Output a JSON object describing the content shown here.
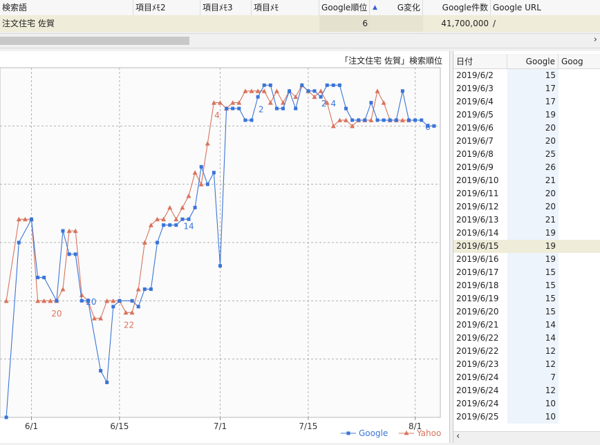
{
  "table": {
    "columns": [
      "検索語",
      "項目ﾒﾓ2",
      "項目ﾒﾓ3",
      "項目ﾒﾓ",
      "Google順位",
      "G変化",
      "Google件数",
      "Google URL"
    ],
    "sort_icon": "sort-ascending-icon",
    "row": {
      "keyword": "注文住宅 佐賀",
      "memo2": "",
      "memo3": "",
      "memo": "",
      "google_rank": "6",
      "g_change": "",
      "google_count": "41,700,000",
      "google_url": "/"
    }
  },
  "scroll_right_icon": "chevron-right-icon",
  "chart_data": {
    "type": "line",
    "title": "「注文住宅 佐賀」検索順位",
    "x_tick_labels": [
      "6/1",
      "6/15",
      "7/1",
      "7/15",
      "8/1"
    ],
    "y_axis": {
      "reversed": true,
      "visible_range": [
        1,
        30
      ],
      "gridlines": [
        5,
        10,
        15,
        20,
        25
      ],
      "tick_labels_visible": false
    },
    "grid": true,
    "legend": "bottom-right",
    "series": [
      {
        "name": "Google",
        "color": "#3a74d8",
        "marker": "square",
        "points": [
          [
            -4,
            30
          ],
          [
            -2,
            15
          ],
          [
            0,
            13
          ],
          [
            1,
            18
          ],
          [
            2,
            18
          ],
          [
            4,
            20
          ],
          [
            5,
            14
          ],
          [
            6,
            16
          ],
          [
            7,
            16
          ],
          [
            8,
            20
          ],
          [
            9,
            20
          ],
          [
            11,
            26
          ],
          [
            12,
            27
          ],
          [
            13,
            20.5
          ],
          [
            14,
            20
          ],
          [
            16,
            20
          ],
          [
            17,
            20.5
          ],
          [
            18,
            19
          ],
          [
            19,
            19
          ],
          [
            20,
            15
          ],
          [
            21,
            13.5
          ],
          [
            22,
            13.5
          ],
          [
            23,
            13.5
          ],
          [
            24,
            13
          ],
          [
            25,
            13
          ],
          [
            26,
            12
          ],
          [
            27,
            8.5
          ],
          [
            28,
            10
          ],
          [
            29,
            9
          ],
          [
            30,
            17
          ],
          [
            31,
            3.5
          ],
          [
            32,
            3.5
          ],
          [
            33,
            3.5
          ],
          [
            34,
            4.5
          ],
          [
            35,
            4.5
          ],
          [
            36,
            2.5
          ],
          [
            37,
            1.5
          ],
          [
            38,
            1.5
          ],
          [
            39,
            3.5
          ],
          [
            40,
            3.5
          ],
          [
            41,
            2
          ],
          [
            42,
            3.5
          ],
          [
            43,
            1.5
          ],
          [
            44,
            2
          ],
          [
            45,
            2
          ],
          [
            46,
            2.5
          ],
          [
            47,
            1.5
          ],
          [
            48,
            1.5
          ],
          [
            49,
            1.5
          ],
          [
            50,
            3.5
          ],
          [
            51,
            4.5
          ],
          [
            52,
            4.5
          ],
          [
            53,
            4.5
          ],
          [
            54,
            3
          ],
          [
            55,
            4.5
          ],
          [
            56,
            4.5
          ],
          [
            57,
            4.5
          ],
          [
            58,
            4.5
          ],
          [
            59,
            2
          ],
          [
            60,
            4.5
          ],
          [
            61,
            4.5
          ],
          [
            62,
            4.5
          ],
          [
            63,
            5
          ],
          [
            64,
            5
          ]
        ],
        "point_labels": [
          {
            "x": 9.5,
            "y": 19.5,
            "text": "20"
          },
          {
            "x": 25,
            "y": 13,
            "text": "14"
          },
          {
            "x": 36.5,
            "y": 3,
            "text": "2"
          },
          {
            "x": 46.5,
            "y": 2.5,
            "text": "2"
          },
          {
            "x": 48,
            "y": 2.5,
            "text": "4"
          },
          {
            "x": 63,
            "y": 4.5,
            "text": "6"
          }
        ]
      },
      {
        "name": "Yahoo",
        "color": "#d9735c",
        "marker": "triangle",
        "points": [
          [
            -4,
            20
          ],
          [
            -2,
            13
          ],
          [
            -1,
            13
          ],
          [
            0,
            13
          ],
          [
            1,
            20
          ],
          [
            2,
            20
          ],
          [
            3,
            20
          ],
          [
            4,
            20
          ],
          [
            5,
            19
          ],
          [
            6,
            14
          ],
          [
            7,
            14
          ],
          [
            8,
            19.5
          ],
          [
            9,
            20
          ],
          [
            10,
            21.5
          ],
          [
            11,
            21.5
          ],
          [
            12,
            20
          ],
          [
            13,
            20
          ],
          [
            14,
            20
          ],
          [
            15,
            21
          ],
          [
            16,
            21
          ],
          [
            17,
            19
          ],
          [
            18,
            15
          ],
          [
            19,
            13.5
          ],
          [
            20,
            13
          ],
          [
            21,
            13
          ],
          [
            22,
            12
          ],
          [
            23,
            13
          ],
          [
            24,
            12
          ],
          [
            25,
            11
          ],
          [
            26,
            9
          ],
          [
            27,
            10
          ],
          [
            28,
            6.5
          ],
          [
            29,
            3
          ],
          [
            30,
            3
          ],
          [
            31,
            3.5
          ],
          [
            32,
            3
          ],
          [
            33,
            3
          ],
          [
            34,
            2
          ],
          [
            35,
            2
          ],
          [
            36,
            2
          ],
          [
            37,
            2
          ],
          [
            38,
            3
          ],
          [
            39,
            2
          ],
          [
            40,
            3
          ],
          [
            41,
            2
          ],
          [
            42,
            2.5
          ],
          [
            43,
            1.5
          ],
          [
            44,
            2
          ],
          [
            45,
            2.5
          ],
          [
            46,
            2
          ],
          [
            47,
            3
          ],
          [
            48,
            5
          ],
          [
            49,
            4.5
          ],
          [
            50,
            4.5
          ],
          [
            51,
            5
          ],
          [
            52,
            4.5
          ],
          [
            53,
            4.5
          ],
          [
            54,
            4.5
          ],
          [
            55,
            2
          ],
          [
            56,
            3
          ],
          [
            57,
            4.5
          ],
          [
            58,
            4.5
          ],
          [
            59,
            4.5
          ],
          [
            60,
            4.5
          ]
        ],
        "point_labels": [
          {
            "x": 4,
            "y": 20.5,
            "text": "20"
          },
          {
            "x": 15.5,
            "y": 21.5,
            "text": "22"
          },
          {
            "x": 29.5,
            "y": 3.5,
            "text": "4"
          },
          {
            "x": 46.5,
            "y": 2.5,
            "text": "2"
          }
        ]
      }
    ]
  },
  "history": {
    "columns": [
      "日付",
      "Google",
      "Goog"
    ],
    "selected_index": 13,
    "rows": [
      [
        "2019/6/2",
        "15"
      ],
      [
        "2019/6/3",
        "17"
      ],
      [
        "2019/6/4",
        "17"
      ],
      [
        "2019/6/5",
        "19"
      ],
      [
        "2019/6/6",
        "20"
      ],
      [
        "2019/6/7",
        "20"
      ],
      [
        "2019/6/8",
        "25"
      ],
      [
        "2019/6/9",
        "26"
      ],
      [
        "2019/6/10",
        "21"
      ],
      [
        "2019/6/11",
        "20"
      ],
      [
        "2019/6/12",
        "20"
      ],
      [
        "2019/6/13",
        "21"
      ],
      [
        "2019/6/14",
        "19"
      ],
      [
        "2019/6/15",
        "19"
      ],
      [
        "2019/6/16",
        "19"
      ],
      [
        "2019/6/17",
        "15"
      ],
      [
        "2019/6/18",
        "15"
      ],
      [
        "2019/6/19",
        "15"
      ],
      [
        "2019/6/20",
        "15"
      ],
      [
        "2019/6/21",
        "14"
      ],
      [
        "2019/6/22",
        "14"
      ],
      [
        "2019/6/22",
        "12"
      ],
      [
        "2019/6/23",
        "12"
      ],
      [
        "2019/6/24",
        "7"
      ],
      [
        "2019/6/24",
        "12"
      ],
      [
        "2019/6/24",
        "10"
      ],
      [
        "2019/6/25",
        "10"
      ]
    ],
    "scroll_left_icon": "chevron-left-icon"
  }
}
